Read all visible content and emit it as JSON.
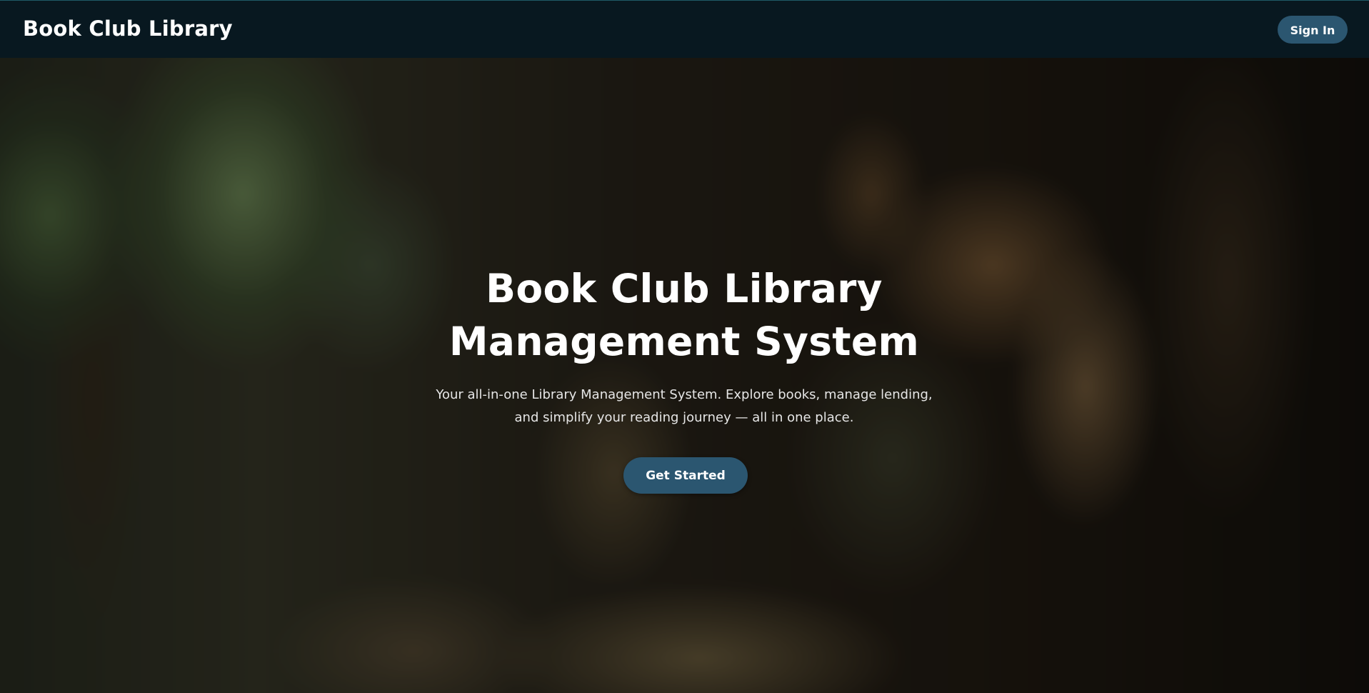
{
  "navbar": {
    "brand": "Book Club Library",
    "signin_label": "Sign In"
  },
  "hero": {
    "title_line1": "Book Club Library",
    "title_line2": "Management System",
    "subtitle_line1": "Your all-in-one Library Management System. Explore books, manage lending,",
    "subtitle_line2": "and simplify your reading journey — all in one place.",
    "cta_label": "Get Started"
  },
  "colors": {
    "navbar_bg": "#081820",
    "button_bg": "#2b5670",
    "text": "#ffffff"
  }
}
